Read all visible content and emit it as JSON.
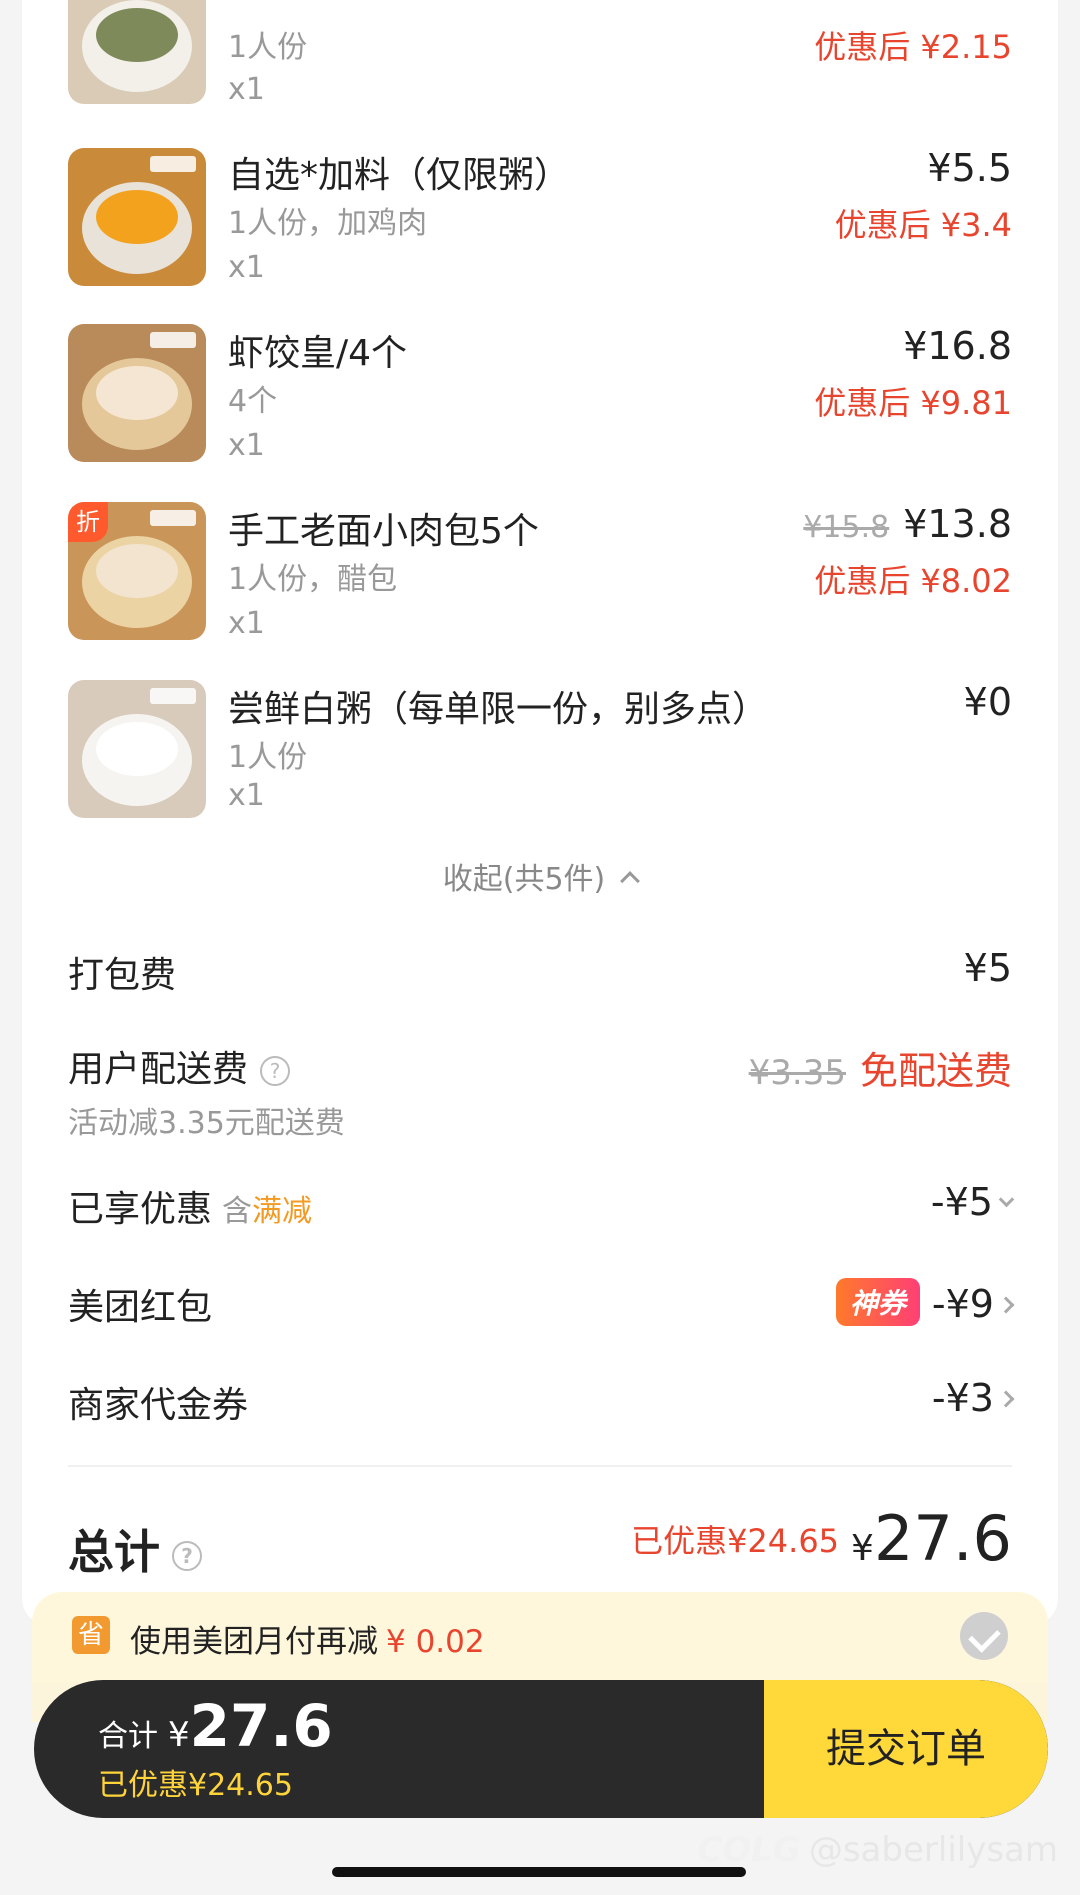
{
  "items": [
    {
      "spec": "1人份",
      "qty": "x1",
      "after": "优惠后 ¥2.15"
    },
    {
      "name": "自选*加料（仅限粥）",
      "spec": "1人份，加鸡肉",
      "qty": "x1",
      "price": "¥5.5",
      "after": "优惠后 ¥3.4"
    },
    {
      "name": "虾饺皇/4个",
      "spec": "4个",
      "qty": "x1",
      "price": "¥16.8",
      "after": "优惠后 ¥9.81"
    },
    {
      "name": "手工老面小肉包5个",
      "spec": "1人份，醋包",
      "qty": "x1",
      "old_price": "¥15.8",
      "price": "¥13.8",
      "after": "优惠后 ¥8.02",
      "badge": "折"
    },
    {
      "name": "尝鲜白粥（每单限一份，别多点）",
      "spec": "1人份",
      "qty": "x1",
      "price": "¥0"
    }
  ],
  "collapse_label": "收起(共5件)",
  "fees": {
    "packing": {
      "label": "打包费",
      "value": "¥5"
    },
    "delivery": {
      "label": "用户配送费",
      "note": "活动减3.35元配送费",
      "old": "¥3.35",
      "value": "免配送费",
      "help": "?"
    },
    "discount": {
      "label": "已享优惠",
      "tag_prefix": "含",
      "tag": "满减",
      "value": "-¥5"
    },
    "redpacket": {
      "label": "美团红包",
      "badge": "神券",
      "value": "-¥9"
    },
    "voucher": {
      "label": "商家代金券",
      "value": "-¥3"
    }
  },
  "total": {
    "label": "总计",
    "help": "?",
    "saved": "已优惠¥24.65",
    "yen": "¥",
    "amount": "27.6"
  },
  "pay_tip": {
    "icon": "省",
    "text": "使用美团月付再减",
    "amount": "¥ 0.02"
  },
  "bottom": {
    "label": "合计",
    "yen": "¥",
    "amount": "27.6",
    "saved": "已优惠¥24.65",
    "submit": "提交订单"
  },
  "watermark": {
    "logo": "COLG",
    "handle": "@saberlilysam"
  },
  "colors": {
    "accent_red": "#e8452f",
    "submit_yellow": "#ffd93a",
    "bar_dark": "#2a2a2a",
    "tag_orange": "#f39a22"
  }
}
